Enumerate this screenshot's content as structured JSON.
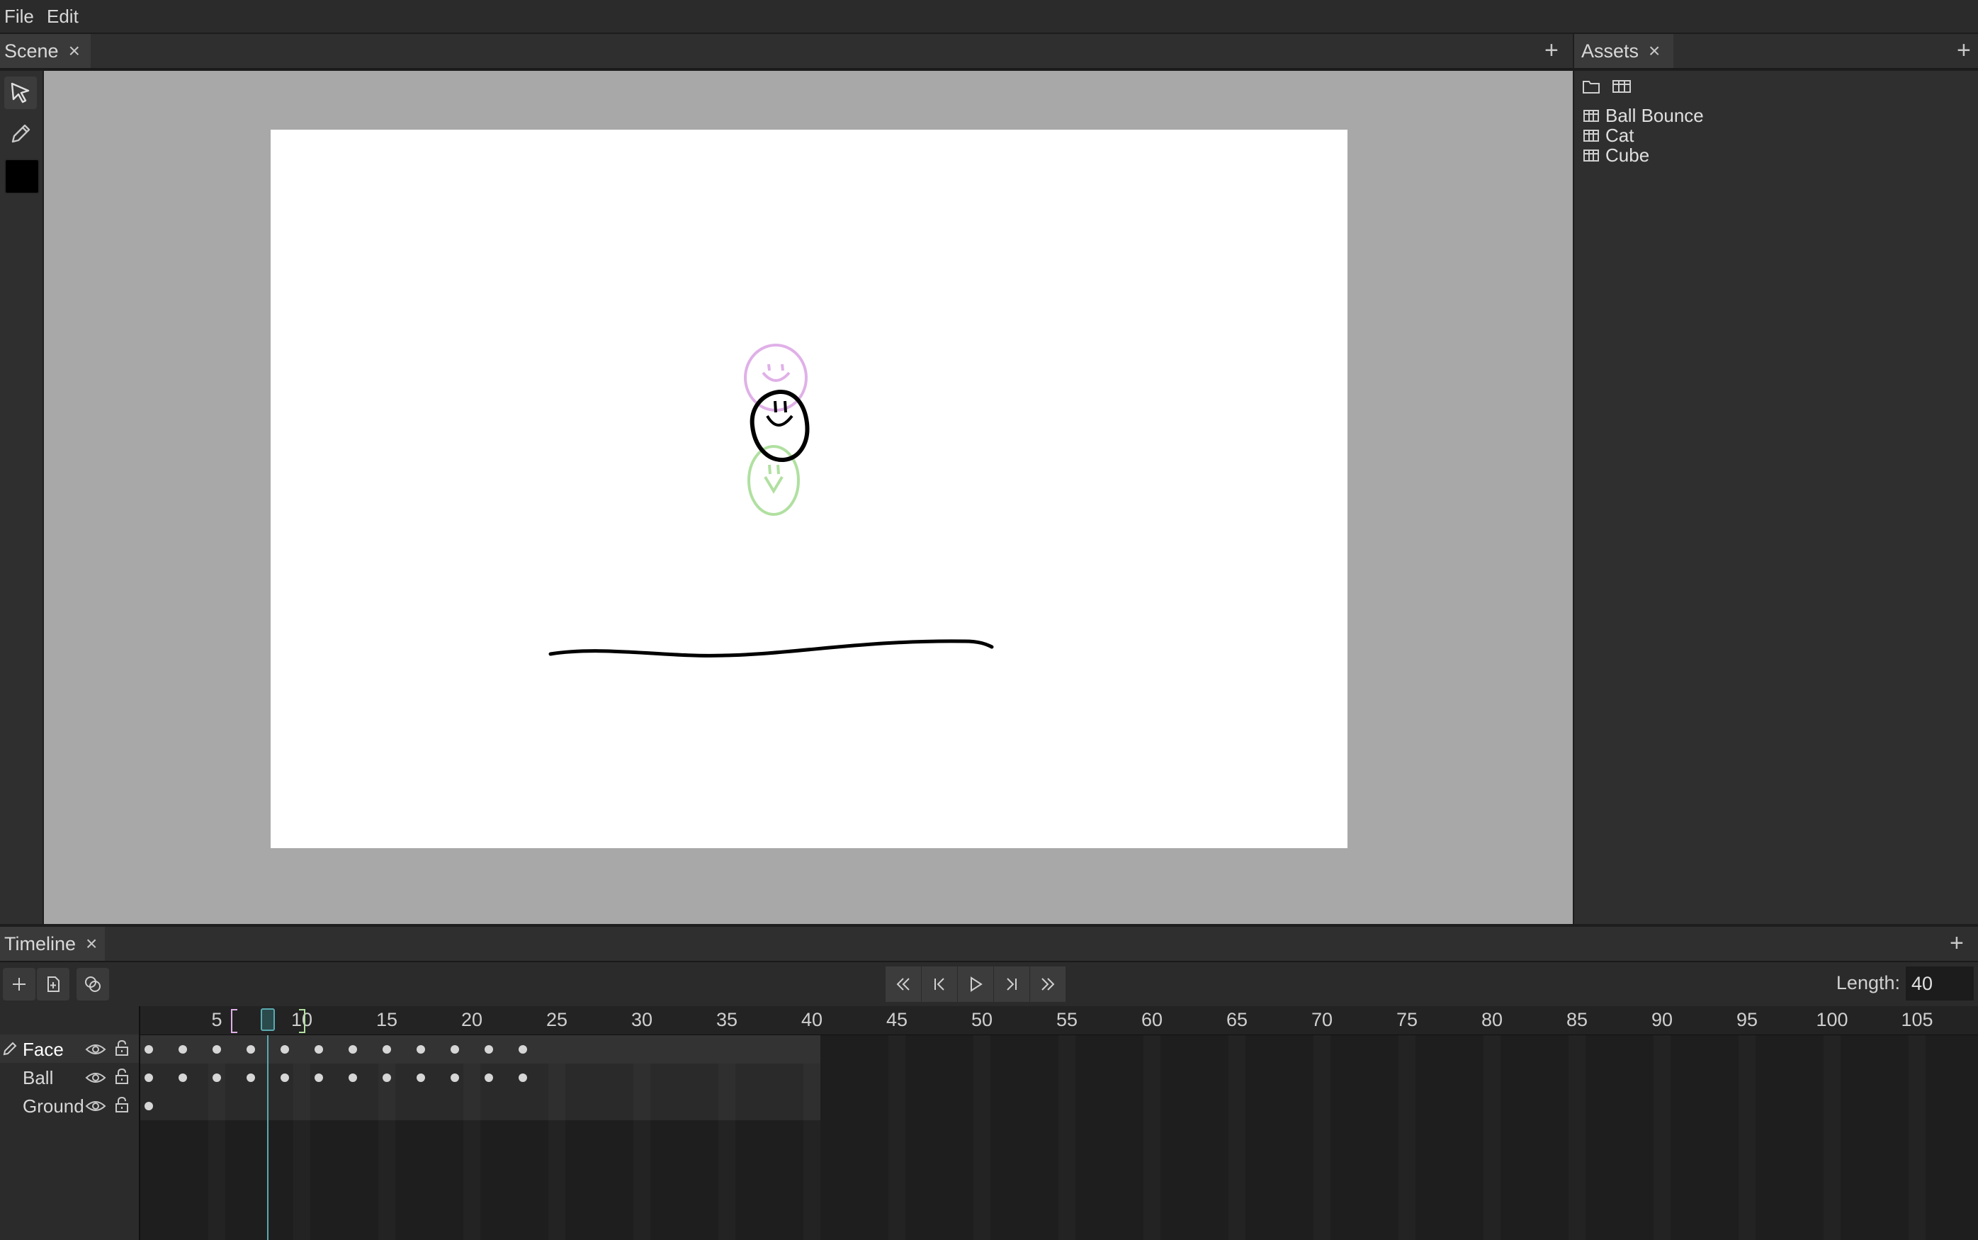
{
  "menu": {
    "file": "File",
    "edit": "Edit"
  },
  "scene_tab": {
    "label": "Scene",
    "close": "×"
  },
  "assets_tab": {
    "label": "Assets",
    "close": "×"
  },
  "timeline_tab": {
    "label": "Timeline",
    "close": "×"
  },
  "plus": "+",
  "colors": {
    "current_color": "#000000",
    "onion_prev": "#e0b0e8",
    "onion_next": "#b0e0a0",
    "playhead": "#5aaab0"
  },
  "assets": {
    "items": [
      {
        "label": "Ball Bounce",
        "icon": "film-icon"
      },
      {
        "label": "Cat",
        "icon": "film-icon"
      },
      {
        "label": "Cube",
        "icon": "film-icon"
      }
    ]
  },
  "timeline": {
    "length_label": "Length:",
    "length_value": "40",
    "current_frame": 8,
    "onion_start": 6,
    "onion_end": 10,
    "ruler_labels": [
      "5",
      "10",
      "15",
      "20",
      "25",
      "30",
      "35",
      "40",
      "45",
      "50",
      "55",
      "60",
      "65",
      "70",
      "75",
      "80",
      "85",
      "90",
      "95",
      "100",
      "105"
    ],
    "layers": [
      {
        "name": "Face",
        "keyframes": [
          1,
          3,
          5,
          7,
          9,
          11,
          13,
          15,
          17,
          19,
          21,
          23
        ],
        "active": true
      },
      {
        "name": "Ball",
        "keyframes": [
          1,
          3,
          5,
          7,
          9,
          11,
          13,
          15,
          17,
          19,
          21,
          23
        ],
        "active": false
      },
      {
        "name": "Ground",
        "keyframes": [
          1
        ],
        "active": false
      }
    ]
  }
}
